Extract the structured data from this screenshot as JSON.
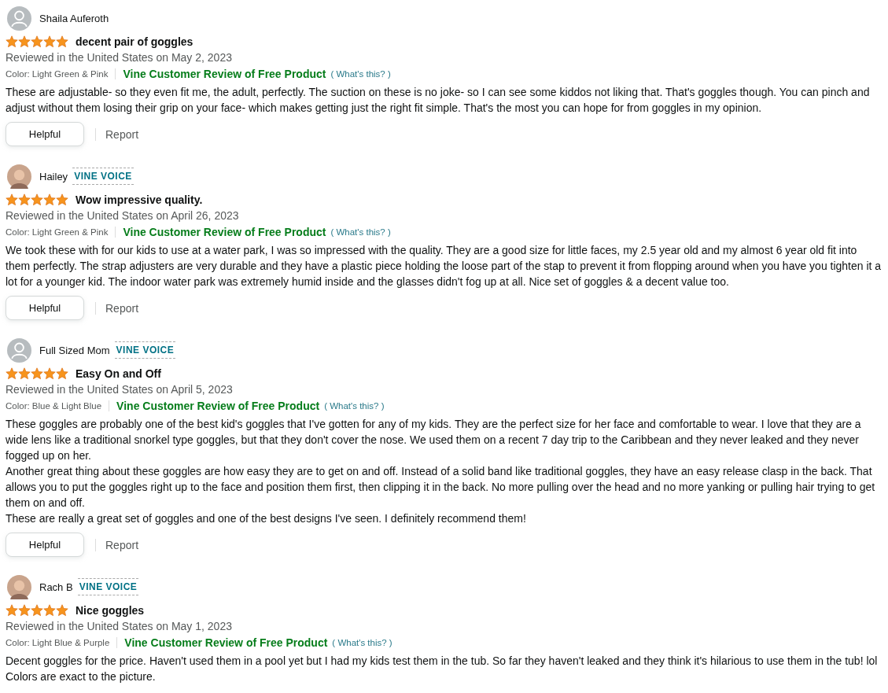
{
  "reviews": [
    {
      "author": "Shaila Auferoth",
      "avatar": {
        "kind": "default"
      },
      "stars": 5,
      "title": "decent pair of goggles",
      "date": "Reviewed in the United States on May 2, 2023",
      "variant": "Color: Light Green & Pink",
      "vine_label": "Vine Customer Review of Free Product",
      "whats_this": "( What's this? )",
      "body": [
        "These are adjustable- so they even fit me, the adult, perfectly. The suction on these is no joke- so I can see some kiddos not liking that. That's goggles though. You can pinch and adjust without them losing their grip on your face- which makes getting just the right fit simple. That's the most you can hope for from goggles in my opinion."
      ],
      "helpful": "Helpful",
      "report": "Report"
    },
    {
      "author": "Hailey",
      "badge": "VINE VOICE",
      "avatar": {
        "kind": "photo"
      },
      "stars": 5,
      "title": "Wow impressive quality.",
      "date": "Reviewed in the United States on April 26, 2023",
      "variant": "Color: Light Green & Pink",
      "vine_label": "Vine Customer Review of Free Product",
      "whats_this": "( What's this? )",
      "body": [
        "We took these with for our kids to use at a water park, I was so impressed with the quality. They are a good size for little faces, my 2.5 year old and my almost 6 year old fit into them perfectly. The strap adjusters are very durable and they have a plastic piece holding the loose part of the stap to prevent it from flopping around when you have you tighten it a lot for a younger kid. The indoor water park was extremely humid inside and the glasses didn't fog up at all. Nice set of goggles & a decent value too."
      ],
      "helpful": "Helpful",
      "report": "Report"
    },
    {
      "author": "Full Sized Mom",
      "badge": "VINE VOICE",
      "avatar": {
        "kind": "default"
      },
      "stars": 5,
      "title": "Easy On and Off",
      "date": "Reviewed in the United States on April 5, 2023",
      "variant": "Color: Blue & Light Blue",
      "vine_label": "Vine Customer Review of Free Product",
      "whats_this": "( What's this? )",
      "body": [
        "These goggles are probably one of the best kid's goggles that I've gotten for any of my kids. They are the perfect size for her face and comfortable to wear. I love that they are a wide lens like a traditional snorkel type goggles, but that they don't cover the nose. We used them on a recent 7 day trip to the Caribbean and they never leaked and they never fogged up on her.",
        "Another great thing about these goggles are how easy they are to get on and off. Instead of a solid band like traditional goggles, they have an easy release clasp in the back. That allows you to put the goggles right up to the face and position them first, then clipping it in the back. No more pulling over the head and no more yanking or pulling hair trying to get them on and off.",
        "These are really a great set of goggles and one of the best designs I've seen. I definitely recommend them!"
      ],
      "helpful": "Helpful",
      "report": "Report"
    },
    {
      "author": "Rach B",
      "badge": "VINE VOICE",
      "avatar": {
        "kind": "photo"
      },
      "stars": 5,
      "title": "Nice goggles",
      "date": "Reviewed in the United States on May 1, 2023",
      "variant": "Color: Light Blue & Purple",
      "vine_label": "Vine Customer Review of Free Product",
      "whats_this": "( What's this? )",
      "body": [
        "Decent goggles for the price. Haven't used them in a pool yet but I had my kids test them in the tub. So far they haven't leaked and they think it's hilarious to use them in the tub! lol Colors are exact to the picture."
      ]
    }
  ]
}
